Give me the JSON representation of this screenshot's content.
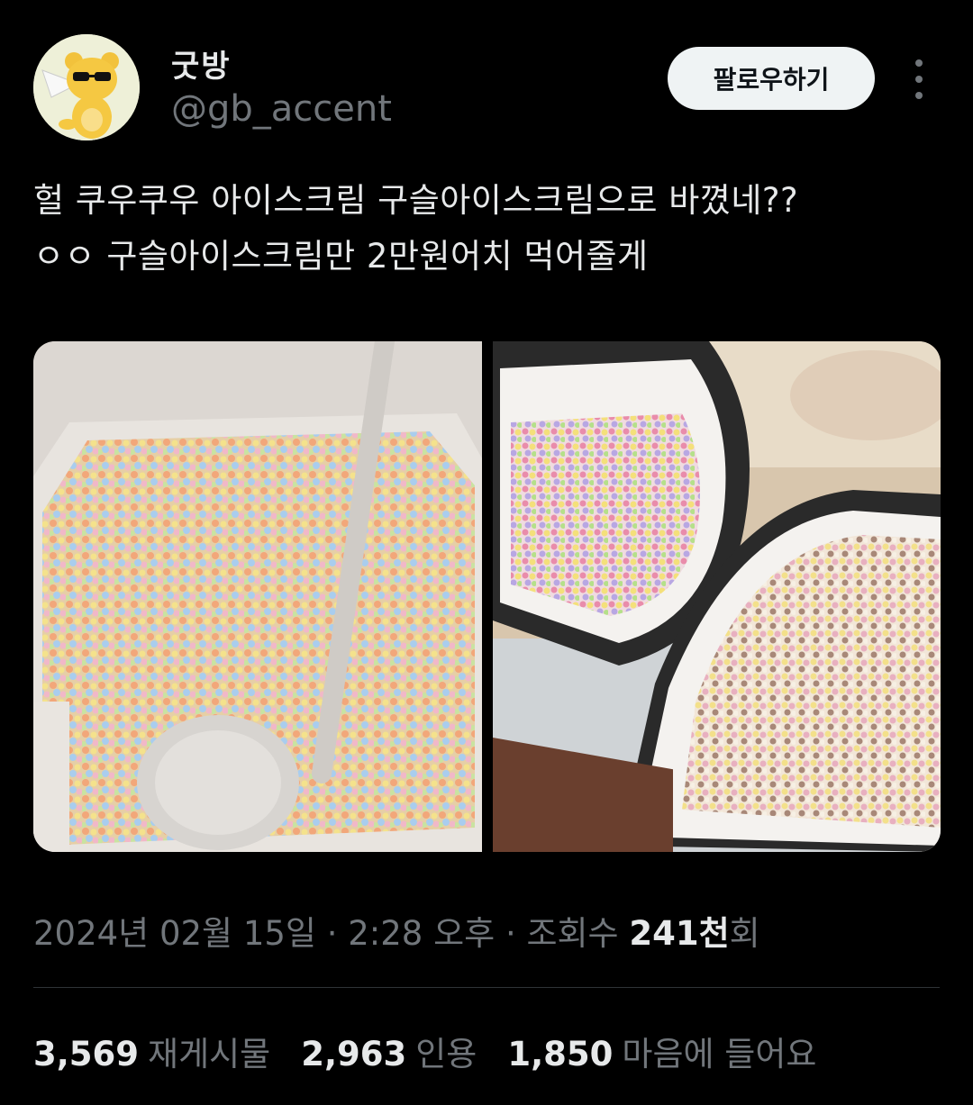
{
  "user": {
    "display_name": "굿방",
    "handle": "@gb_accent"
  },
  "actions": {
    "follow_label": "팔로우하기",
    "more_icon": "more-vertical-icon"
  },
  "tweet": {
    "line1": "헐 쿠우쿠우 아이스크림 구슬아이스크림으로 바꼈네??",
    "line2": "ㅇㅇ 구슬아이스크림만 2만원어치 먹어줄게"
  },
  "meta": {
    "datetime": "2024년 02월 15일 · 2:28 오후 · 조회수 ",
    "views_num": "241천",
    "views_suffix": "회"
  },
  "stats": [
    {
      "num": "3,569",
      "label": "재게시물"
    },
    {
      "num": "2,963",
      "label": "인용"
    },
    {
      "num": "1,850",
      "label": "마음에 들어요"
    }
  ]
}
